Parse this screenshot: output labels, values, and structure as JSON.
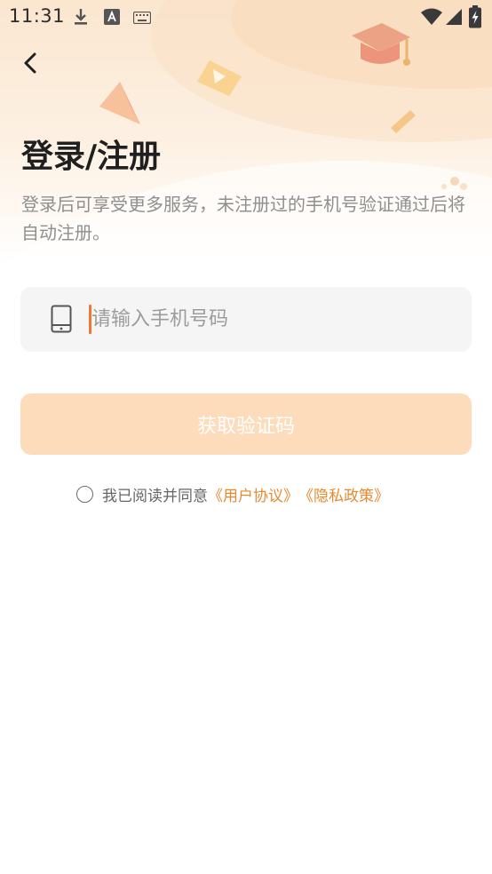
{
  "status_bar": {
    "time": "11:31"
  },
  "header": {
    "back_icon": "chevron-left-icon"
  },
  "main": {
    "title": "登录/注册",
    "subtitle": "登录后可享受更多服务，未注册过的手机号验证通过后将自动注册。"
  },
  "phone_field": {
    "icon": "mobile-phone-icon",
    "placeholder": "请输入手机号码",
    "value": ""
  },
  "get_code_button": {
    "label": "获取验证码"
  },
  "agreement": {
    "checked": false,
    "prefix": "我已阅读并同意",
    "user_agreement": "《用户协议》",
    "privacy_policy": "《隐私政策》"
  },
  "colors": {
    "accent": "#e8892f",
    "caret": "#ee7a2f",
    "button_disabled_bg": "#fddcbc",
    "input_bg": "#f5f5f5"
  }
}
